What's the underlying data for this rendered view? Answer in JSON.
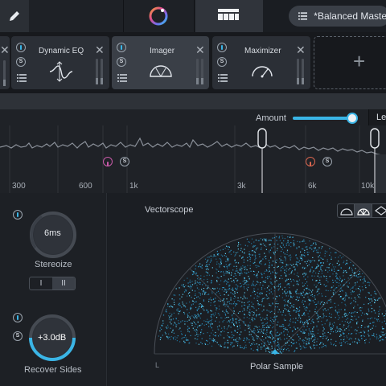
{
  "topbar": {
    "edit_icon": "pencil-icon",
    "assistant_icon": "assistant-orb-icon",
    "grid_icon": "module-grid-icon",
    "preset_icon": "list-icon",
    "preset_name": "*Balanced Master"
  },
  "chain": {
    "modules": [
      {
        "name": "Dynamic EQ",
        "icon": "dynamic-eq-icon"
      },
      {
        "name": "Imager",
        "icon": "imager-icon"
      },
      {
        "name": "Maximizer",
        "icon": "maximizer-icon"
      }
    ],
    "add_icon": "plus-icon"
  },
  "spectrum": {
    "amount_label": "Amount",
    "amount_value": 0.9,
    "learn_label": "Lea",
    "freq_labels": [
      "300",
      "600",
      "1k",
      "3k",
      "6k",
      "10k"
    ],
    "band_dividers": [
      326,
      466
    ],
    "accent_color": "#3ab5e6",
    "marker_color": "#c85aa8",
    "marker_color_2": "#d9664f"
  },
  "stereoize": {
    "value": "6ms",
    "label": "Stereoize",
    "segments": [
      "I",
      "II"
    ],
    "active_segment": "II"
  },
  "recover": {
    "value": "+3.0dB",
    "label": "Recover Sides"
  },
  "vectorscope": {
    "title": "Vectorscope",
    "mode": "Polar Sample",
    "left_label": "L",
    "modes": [
      "polar-level-icon",
      "polar-sample-icon",
      "lissajous-icon"
    ]
  }
}
